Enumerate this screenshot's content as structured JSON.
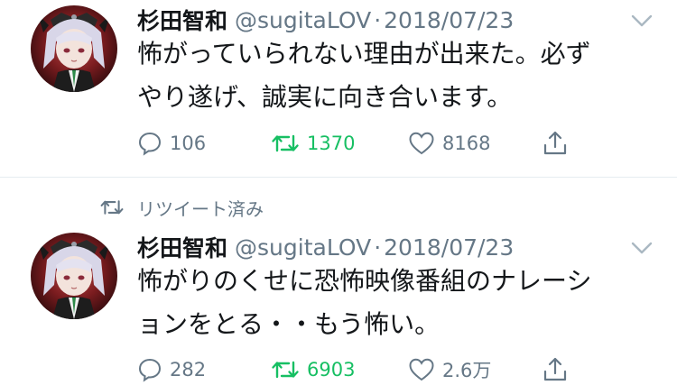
{
  "tweets": [
    {
      "name": "杉田智和",
      "handle": "@sugitaLOV",
      "date": "2018/07/23",
      "lines": [
        "怖がっていられない理由が出来た。必ず",
        "やり遂げ、誠実に向き合います。"
      ],
      "replies": "106",
      "retweets": "1370",
      "likes": "8168"
    },
    {
      "retweet_context": "リツイート済み",
      "name": "杉田智和",
      "handle": "@sugitaLOV",
      "date": "2018/07/23",
      "lines": [
        "怖がりのくせに恐怖映像番組のナレーシ",
        "ョンをとる・・もう怖い。"
      ],
      "replies": "282",
      "retweets": "6903",
      "likes": "2.6万"
    }
  ],
  "colors": {
    "retweet_green": "#17bf63",
    "secondary_gray": "#657786",
    "text_dark": "#14171a"
  },
  "icons": {
    "reply": "reply-icon",
    "retweet": "retweet-icon",
    "like": "heart-icon",
    "share": "share-icon",
    "menu": "chevron-down-icon"
  }
}
